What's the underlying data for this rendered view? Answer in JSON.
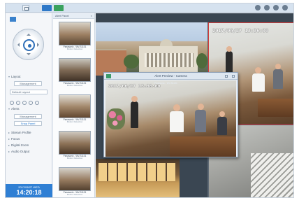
{
  "taskbar": {
    "title": "",
    "main_menu_icon": "grid-icon",
    "app_icons": [
      "surveillance-station-icon",
      "live-view-icon"
    ],
    "tray_icons": [
      "chat-icon",
      "user-icon",
      "search-icon",
      "options-icon"
    ]
  },
  "left_panel": {
    "layout_label": "Layout",
    "layout_button": "Management",
    "layout_select": "Default Layout",
    "alerts_label": "Alerts",
    "alerts_button": "Management",
    "snapshot_button": "Snap Panel",
    "menu_items": [
      "Stream Profile",
      "Focus",
      "Digital Zoom",
      "Audio Output"
    ],
    "clock": {
      "date": "2017/06/27  WED",
      "time": "14:20:18"
    },
    "colors": {
      "accent": "#2f7fd4"
    }
  },
  "thumbnails": {
    "header": "Alert Panel",
    "items": [
      {
        "camera": "Panasonic - WV-S1131",
        "detail": "Motion Detection"
      },
      {
        "camera": "Panasonic - WV-S1131",
        "detail": "Motion Detection"
      },
      {
        "camera": "Panasonic - WV-S1131",
        "detail": "Motion Detection"
      },
      {
        "camera": "Panasonic - WV-S1131",
        "detail": "Motion Detection"
      },
      {
        "camera": "Panasonic - WV-S1131",
        "detail": "Motion Detection"
      }
    ]
  },
  "main_view": {
    "top_left_label": "",
    "top_right_timestamp": "2017/06/27  13:36:00",
    "selected_color": "#d23b3b"
  },
  "popup": {
    "title": "Alert Preview - Camera",
    "timestamp": "2017/06/27  13:36:00",
    "sublabel": "Panasonic - WV-S1131"
  }
}
